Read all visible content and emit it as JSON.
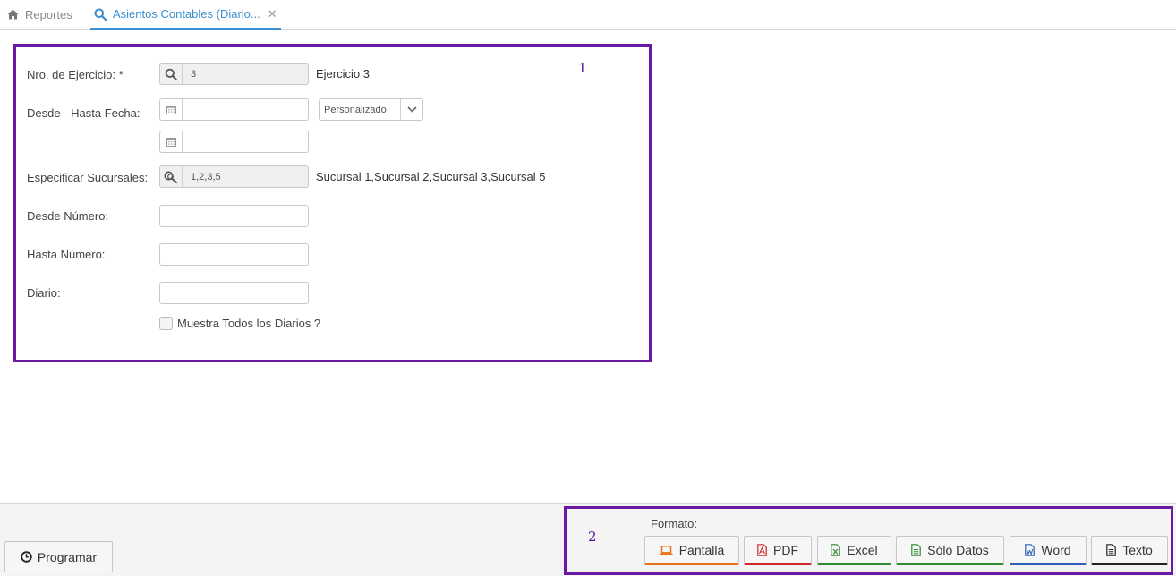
{
  "tabs": {
    "reportes": {
      "label": "Reportes",
      "icon": "home-icon"
    },
    "active": {
      "label": "Asientos Contables (Diario...",
      "icon": "search-icon"
    }
  },
  "annotations": {
    "one": "1",
    "two": "2"
  },
  "form": {
    "ejercicio": {
      "label": "Nro. de Ejercicio: *",
      "value": "3",
      "description": "Ejercicio 3"
    },
    "fechas": {
      "label": "Desde - Hasta Fecha:",
      "desde_value": "",
      "hasta_value": "",
      "period_selected": "Personalizado"
    },
    "sucursales": {
      "label": "Especificar Sucursales:",
      "value": "1,2,3,5",
      "description": "Sucursal 1,Sucursal 2,Sucursal 3,Sucursal 5"
    },
    "desde_numero": {
      "label": "Desde Número:",
      "value": ""
    },
    "hasta_numero": {
      "label": "Hasta Número:",
      "value": ""
    },
    "diario": {
      "label": "Diario:",
      "value": ""
    },
    "muestra_todos": {
      "label": "Muestra Todos los Diarios ?",
      "checked": false
    }
  },
  "footer": {
    "programar_label": "Programar",
    "formato_label": "Formato:",
    "formats": [
      {
        "label": "Pantalla",
        "icon": "laptop-icon",
        "color": "#e8731b"
      },
      {
        "label": "PDF",
        "icon": "pdf-file-icon",
        "color": "#d0262a"
      },
      {
        "label": "Excel",
        "icon": "excel-file-icon",
        "color": "#2e8b2e"
      },
      {
        "label": "Sólo Datos",
        "icon": "data-file-icon",
        "color": "#2e8b2e"
      },
      {
        "label": "Word",
        "icon": "word-file-icon",
        "color": "#2f5fb8"
      },
      {
        "label": "Texto",
        "icon": "text-file-icon",
        "color": "#222222"
      }
    ]
  },
  "colors": {
    "accent": "#3a8fd0",
    "annotation": "#6a1aa0"
  }
}
